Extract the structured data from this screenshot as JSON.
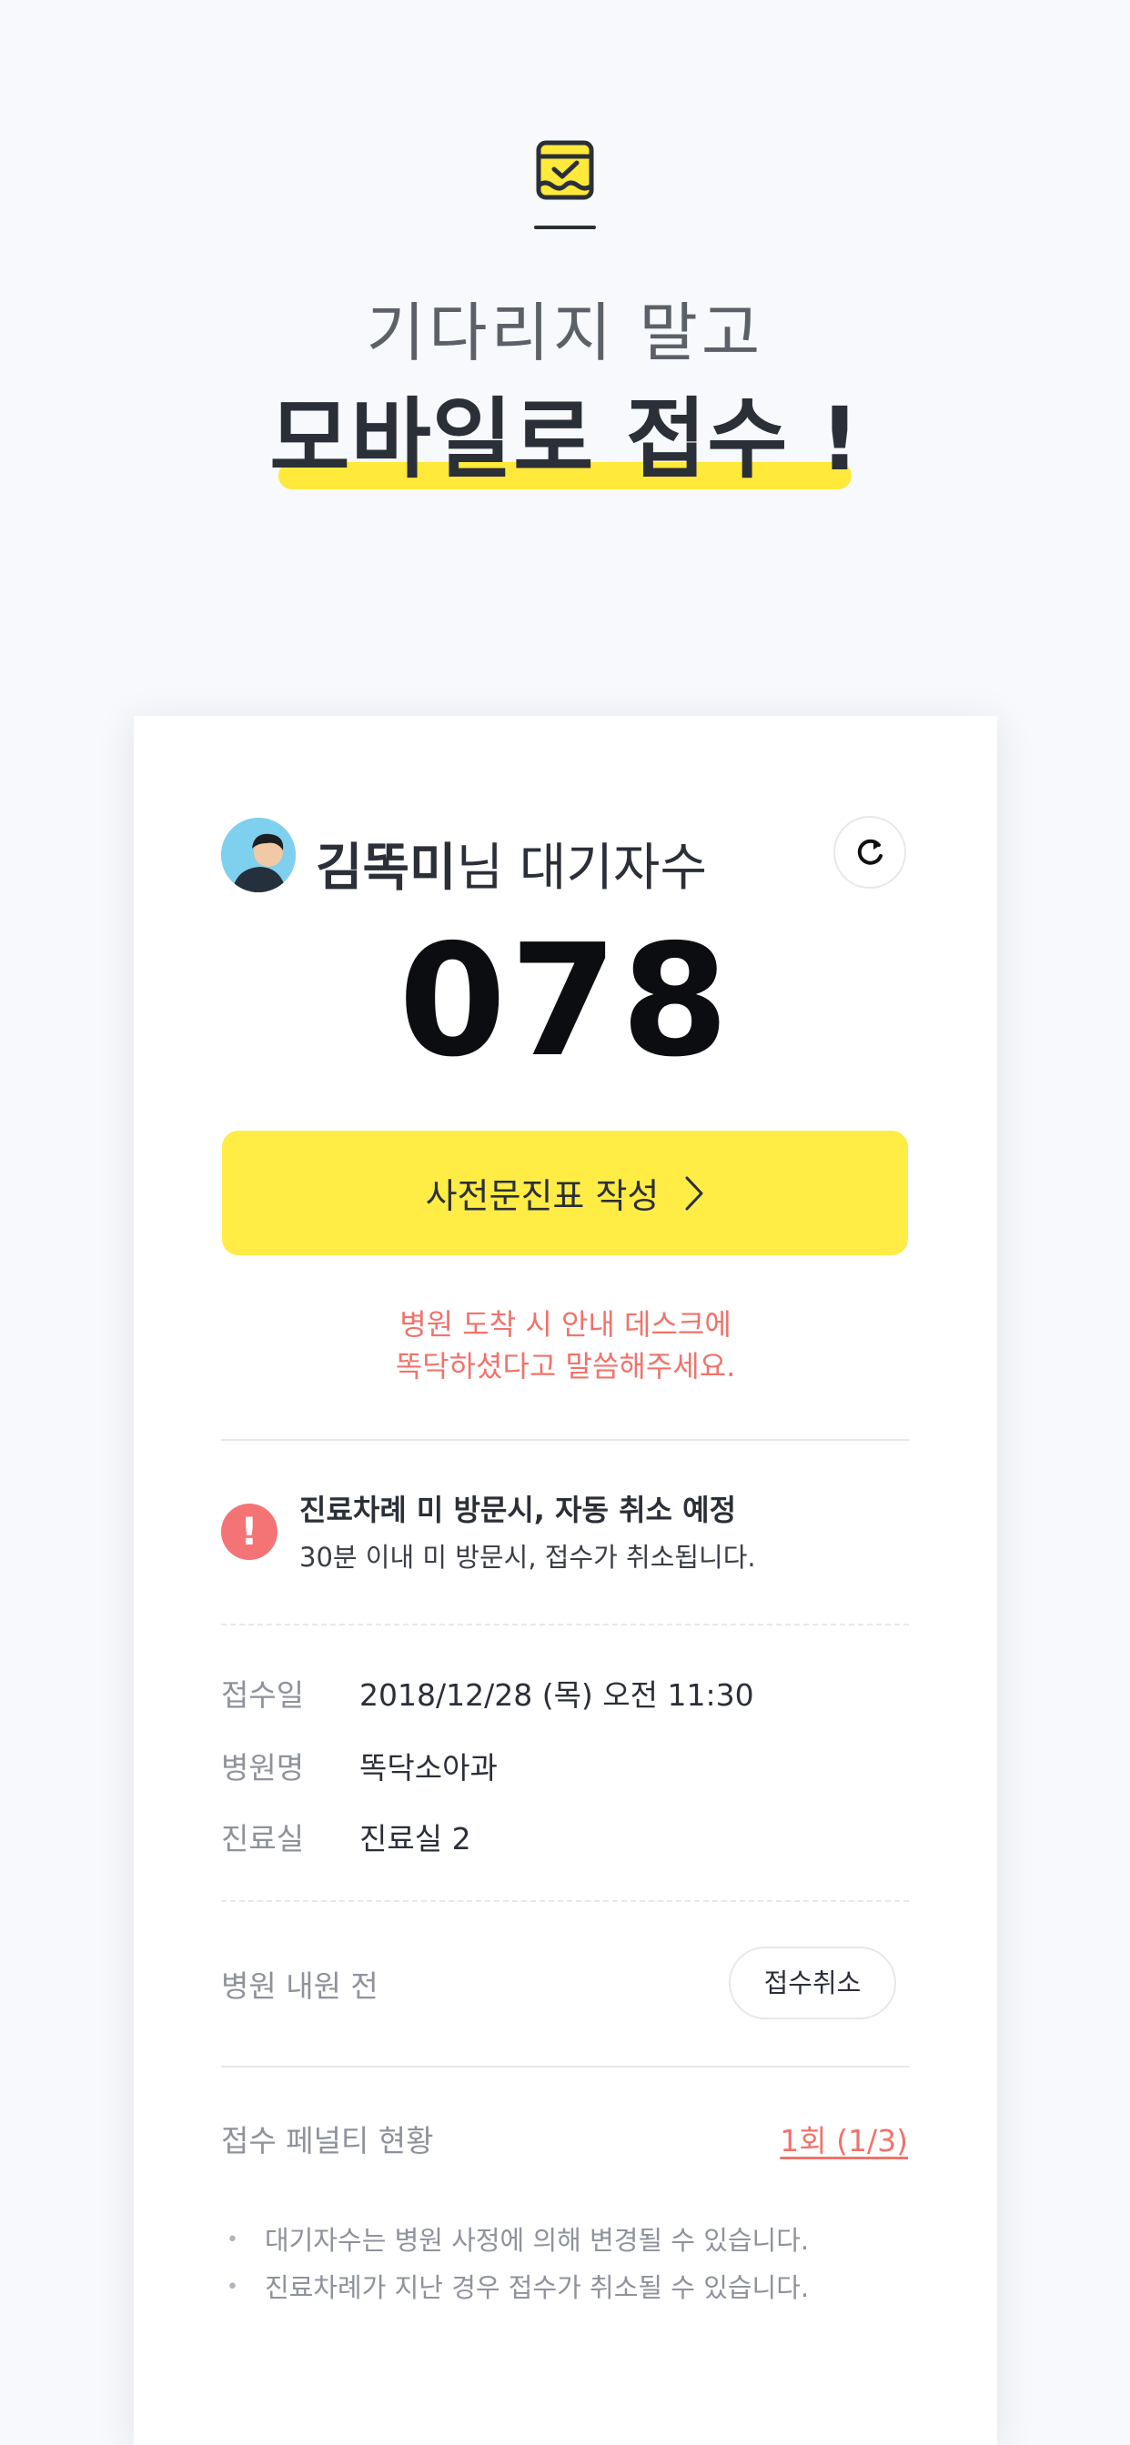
{
  "header": {
    "icon": "receipt-check-icon",
    "subtitle": "기다리지 말고",
    "title": "모바일로 접수 !"
  },
  "card": {
    "user_name": "김똑미",
    "wait_suffix": "님 대기자수",
    "wait_count": "078",
    "primary_button_label": "사전문진표 작성",
    "notice_line1": "병원 도착 시 안내 데스크에",
    "notice_line2": "똑닥하셨다고 말씀해주세요.",
    "warning": {
      "title": "진료차례 미 방문시, 자동 취소 예정",
      "description": "30분 이내 미 방문시, 접수가 취소됩니다."
    },
    "info": [
      {
        "key": "접수일",
        "value": "2018/12/28 (목) 오전 11:30"
      },
      {
        "key": "병원명",
        "value": "똑닥소아과"
      },
      {
        "key": "진료실",
        "value": "진료실 2"
      }
    ],
    "status_label": "병원 내원 전",
    "cancel_button_label": "접수취소",
    "penalty_label": "접수 페널티 현황",
    "penalty_value": "1회 (1/3)",
    "notes": [
      "대기자수는 병원 사정에 의해 변경될 수 있습니다.",
      "진료차례가 지난 경우 접수가 취소될 수 있습니다."
    ]
  },
  "colors": {
    "accent_yellow": "#ffec45",
    "warning_red": "#f0736b",
    "text_dark": "#2b2f38",
    "text_muted": "#8e929b"
  }
}
